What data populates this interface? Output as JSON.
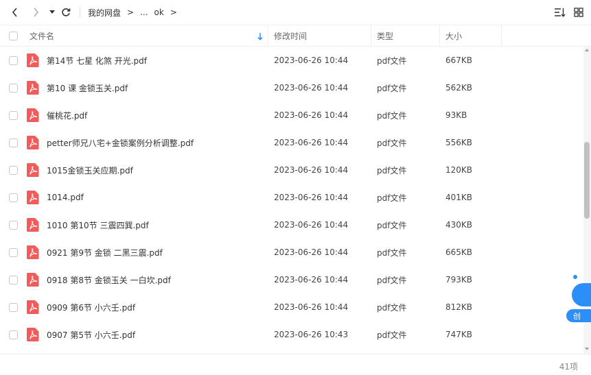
{
  "toolbar": {
    "back_icon": "chevron-left-icon",
    "forward_icon": "chevron-right-icon",
    "history_icon": "caret-down-icon",
    "refresh_icon": "refresh-icon",
    "breadcrumb": [
      "我的网盘",
      "...",
      "ok"
    ],
    "breadcrumb_sep": ">",
    "sort_icon": "sort-list-icon",
    "view_icon": "grid-view-icon"
  },
  "columns": {
    "name": "文件名",
    "modified": "修改时间",
    "type": "类型",
    "size": "大小"
  },
  "files": [
    {
      "name": "第14节 七星 化煞 开光.pdf",
      "modified": "2023-06-26 10:44",
      "type": "pdf文件",
      "size": "667KB"
    },
    {
      "name": "第10 课 金锁玉关.pdf",
      "modified": "2023-06-26 10:44",
      "type": "pdf文件",
      "size": "562KB"
    },
    {
      "name": "催桃花.pdf",
      "modified": "2023-06-26 10:44",
      "type": "pdf文件",
      "size": "93KB"
    },
    {
      "name": "petter师兄八宅+金锁案例分析调整.pdf",
      "modified": "2023-06-26 10:44",
      "type": "pdf文件",
      "size": "556KB"
    },
    {
      "name": "1015金锁玉关应期.pdf",
      "modified": "2023-06-26 10:44",
      "type": "pdf文件",
      "size": "120KB"
    },
    {
      "name": "1014.pdf",
      "modified": "2023-06-26 10:44",
      "type": "pdf文件",
      "size": "401KB"
    },
    {
      "name": "1010 第10节 三震四巽.pdf",
      "modified": "2023-06-26 10:44",
      "type": "pdf文件",
      "size": "430KB"
    },
    {
      "name": "0921 第9节 金锁 二黑三震.pdf",
      "modified": "2023-06-26 10:44",
      "type": "pdf文件",
      "size": "665KB"
    },
    {
      "name": "0918 第8节 金锁玉关 一白坎.pdf",
      "modified": "2023-06-26 10:44",
      "type": "pdf文件",
      "size": "793KB"
    },
    {
      "name": "0909 第6节 小六壬.pdf",
      "modified": "2023-06-26 10:44",
      "type": "pdf文件",
      "size": "812KB"
    },
    {
      "name": "0907 第5节 小六壬.pdf",
      "modified": "2023-06-26 10:43",
      "type": "pdf文件",
      "size": "747KB"
    }
  ],
  "float_widget": {
    "label": "创"
  },
  "footer": {
    "count": "41项"
  },
  "colors": {
    "pdf_icon": "#f25b5b",
    "accent": "#2c8ef8",
    "sort_arrow": "#2c8ef8"
  }
}
